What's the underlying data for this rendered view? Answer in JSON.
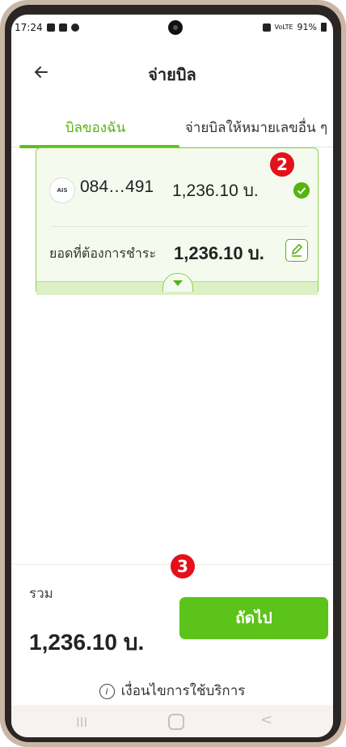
{
  "status_bar": {
    "time": "17:24",
    "battery": "91%",
    "signal_text": "VoLTE"
  },
  "header": {
    "title": "จ่ายบิล",
    "back_icon": "arrow-left-icon"
  },
  "tabs": [
    {
      "label": "บิลของฉัน",
      "active": true
    },
    {
      "label": "จ่ายบิลให้หมายเลขอื่น ๆ",
      "active": false
    }
  ],
  "bill": {
    "provider": "AIS",
    "phone_number": "084…491",
    "amount": "1,236.10 บ.",
    "pay_label": "ยอดที่ต้องการชำระ",
    "pay_amount": "1,236.10 บ."
  },
  "badges": {
    "step_2": "2",
    "step_3": "3"
  },
  "summary": {
    "total_label": "รวม",
    "total_value": "1,236.10 บ.",
    "next_label": "ถัดไป",
    "terms_label": "เงื่อนไขการใช้บริการ"
  },
  "nav": {
    "recent": "III",
    "back": "<"
  },
  "colors": {
    "accent": "#5cc31a",
    "badge": "#e4101b"
  }
}
